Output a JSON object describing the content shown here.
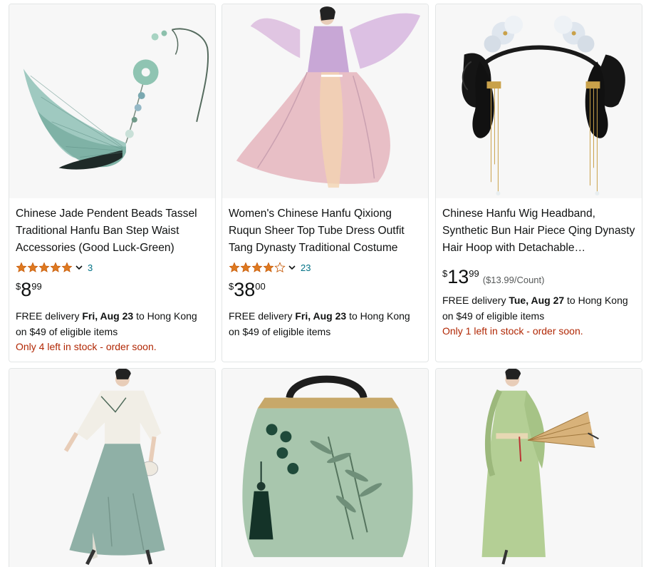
{
  "products": [
    {
      "title": "Chinese Jade Pendent Beads Tassel Traditional Hanfu Ban Step Waist Accessories (Good Luck-Green)",
      "image": "jade-tassel-pendant-image",
      "rating": 5,
      "rating_count": "3",
      "price_currency": "$",
      "price_whole": "8",
      "price_fraction": "99",
      "unit_price": "",
      "delivery_prefix": "FREE delivery ",
      "delivery_date": "Fri, Aug 23",
      "delivery_suffix": " to Hong Kong on $49 of eligible items",
      "stock": "Only 4 left in stock - order soon."
    },
    {
      "title": "Women's Chinese Hanfu Qixiong Ruqun Sheer Top Tube Dress Outfit Tang Dynasty Traditional Costume",
      "image": "pink-hanfu-dress-image",
      "rating": 4,
      "rating_count": "23",
      "price_currency": "$",
      "price_whole": "38",
      "price_fraction": "00",
      "unit_price": "",
      "delivery_prefix": "FREE delivery ",
      "delivery_date": "Fri, Aug 23",
      "delivery_suffix": " to Hong Kong on $49 of eligible items",
      "stock": ""
    },
    {
      "title": "Chinese Hanfu Wig Headband, Synthetic Bun Hair Piece Qing Dynasty Hair Hoop with Detachable…",
      "image": "qing-dynasty-wig-headband-image",
      "rating": 0,
      "rating_count": "",
      "price_currency": "$",
      "price_whole": "13",
      "price_fraction": "99",
      "unit_price": "($13.99/Count)",
      "delivery_prefix": "FREE delivery ",
      "delivery_date": "Tue, Aug 27",
      "delivery_suffix": " to Hong Kong on $49 of eligible items",
      "stock": "Only 1 left in stock - order soon."
    },
    {
      "image": "green-skirt-outfit-image"
    },
    {
      "image": "embroidered-green-handbag-image"
    },
    {
      "image": "green-hanfu-umbrella-image"
    }
  ],
  "colors": {
    "link": "#007185",
    "star": "#de7921",
    "stock": "#b12704",
    "border": "#e3e6e6"
  }
}
